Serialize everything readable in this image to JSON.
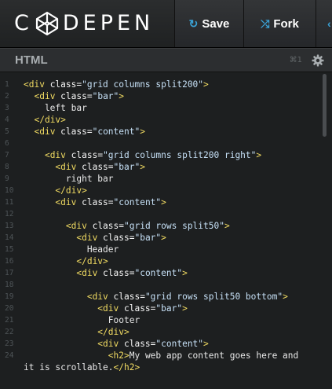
{
  "header": {
    "logo_first": "C",
    "logo_rest": "DEPEN",
    "save_label": "Save",
    "fork_label": "Fork",
    "save_icon": "refresh-icon",
    "fork_icon": "shuffle-icon",
    "accent": "#3aa2d6"
  },
  "editor": {
    "title": "HTML",
    "shortcut": "⌘1",
    "settings_icon": "gear-icon"
  },
  "code_lines": [
    {
      "num": "1",
      "segs": [
        [
          "tag",
          "<div "
        ],
        [
          "attr",
          "class="
        ],
        [
          "str",
          "\"grid columns split200\""
        ],
        [
          "tag",
          ">"
        ]
      ]
    },
    {
      "num": "2",
      "segs": [
        [
          "txt",
          "  "
        ],
        [
          "tag",
          "<div "
        ],
        [
          "attr",
          "class="
        ],
        [
          "str",
          "\"bar\""
        ],
        [
          "tag",
          ">"
        ]
      ]
    },
    {
      "num": "3",
      "segs": [
        [
          "txt",
          "    left bar"
        ]
      ]
    },
    {
      "num": "4",
      "segs": [
        [
          "txt",
          "  "
        ],
        [
          "tag",
          "</div>"
        ]
      ]
    },
    {
      "num": "5",
      "segs": [
        [
          "txt",
          "  "
        ],
        [
          "tag",
          "<div "
        ],
        [
          "attr",
          "class="
        ],
        [
          "str",
          "\"content\""
        ],
        [
          "tag",
          ">"
        ]
      ]
    },
    {
      "num": "6",
      "segs": []
    },
    {
      "num": "7",
      "segs": [
        [
          "txt",
          "    "
        ],
        [
          "tag",
          "<div "
        ],
        [
          "attr",
          "class="
        ],
        [
          "str",
          "\"grid columns split200 right\""
        ],
        [
          "tag",
          ">"
        ]
      ]
    },
    {
      "num": "8",
      "segs": [
        [
          "txt",
          "      "
        ],
        [
          "tag",
          "<div "
        ],
        [
          "attr",
          "class="
        ],
        [
          "str",
          "\"bar\""
        ],
        [
          "tag",
          ">"
        ]
      ]
    },
    {
      "num": "9",
      "segs": [
        [
          "txt",
          "        right bar"
        ]
      ]
    },
    {
      "num": "10",
      "segs": [
        [
          "txt",
          "      "
        ],
        [
          "tag",
          "</div>"
        ]
      ]
    },
    {
      "num": "11",
      "segs": [
        [
          "txt",
          "      "
        ],
        [
          "tag",
          "<div "
        ],
        [
          "attr",
          "class="
        ],
        [
          "str",
          "\"content\""
        ],
        [
          "tag",
          ">"
        ]
      ]
    },
    {
      "num": "12",
      "segs": []
    },
    {
      "num": "13",
      "segs": [
        [
          "txt",
          "        "
        ],
        [
          "tag",
          "<div "
        ],
        [
          "attr",
          "class="
        ],
        [
          "str",
          "\"grid rows split50\""
        ],
        [
          "tag",
          ">"
        ]
      ]
    },
    {
      "num": "14",
      "segs": [
        [
          "txt",
          "          "
        ],
        [
          "tag",
          "<div "
        ],
        [
          "attr",
          "class="
        ],
        [
          "str",
          "\"bar\""
        ],
        [
          "tag",
          ">"
        ]
      ]
    },
    {
      "num": "15",
      "segs": [
        [
          "txt",
          "            Header"
        ]
      ]
    },
    {
      "num": "16",
      "segs": [
        [
          "txt",
          "          "
        ],
        [
          "tag",
          "</div>"
        ]
      ]
    },
    {
      "num": "17",
      "segs": [
        [
          "txt",
          "          "
        ],
        [
          "tag",
          "<div "
        ],
        [
          "attr",
          "class="
        ],
        [
          "str",
          "\"content\""
        ],
        [
          "tag",
          ">"
        ]
      ]
    },
    {
      "num": "18",
      "segs": []
    },
    {
      "num": "19",
      "segs": [
        [
          "txt",
          "            "
        ],
        [
          "tag",
          "<div "
        ],
        [
          "attr",
          "class="
        ],
        [
          "str",
          "\"grid rows split50 bottom\""
        ],
        [
          "tag",
          ">"
        ]
      ]
    },
    {
      "num": "20",
      "segs": [
        [
          "txt",
          "              "
        ],
        [
          "tag",
          "<div "
        ],
        [
          "attr",
          "class="
        ],
        [
          "str",
          "\"bar\""
        ],
        [
          "tag",
          ">"
        ]
      ]
    },
    {
      "num": "21",
      "segs": [
        [
          "txt",
          "                Footer"
        ]
      ]
    },
    {
      "num": "22",
      "segs": [
        [
          "txt",
          "              "
        ],
        [
          "tag",
          "</div>"
        ]
      ]
    },
    {
      "num": "23",
      "segs": [
        [
          "txt",
          "              "
        ],
        [
          "tag",
          "<div "
        ],
        [
          "attr",
          "class="
        ],
        [
          "str",
          "\"content\""
        ],
        [
          "tag",
          ">"
        ]
      ]
    },
    {
      "num": "24",
      "segs": [
        [
          "txt",
          "                "
        ],
        [
          "tag",
          "<h2>"
        ],
        [
          "txt",
          "My web app content goes here and"
        ]
      ]
    },
    {
      "num": "",
      "segs": [
        [
          "txt",
          "it is scrollable."
        ],
        [
          "tag",
          "</h2>"
        ]
      ]
    }
  ]
}
